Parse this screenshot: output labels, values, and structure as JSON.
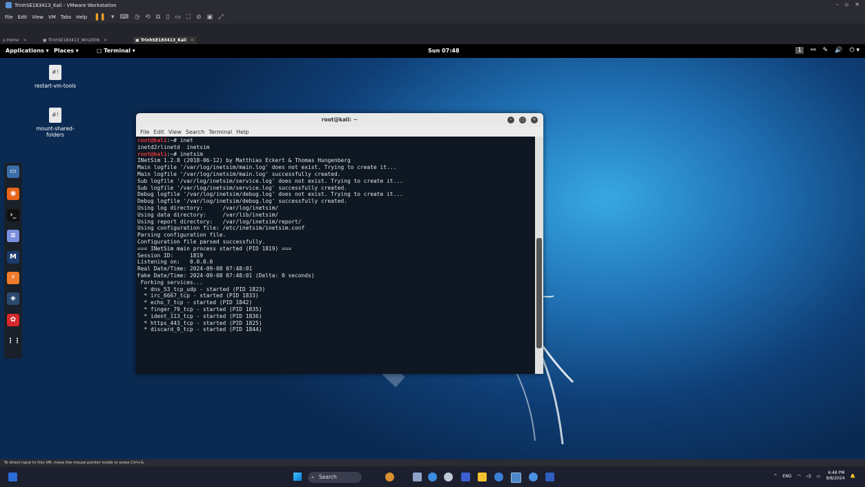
{
  "vm_window": {
    "title": "TrinhSE183413_Kali - VMware Workstation",
    "menu": [
      "File",
      "Edit",
      "View",
      "VM",
      "Tabs",
      "Help"
    ],
    "tabs": [
      {
        "label": "Home"
      },
      {
        "label": "TrinhSE183413_Win2008"
      },
      {
        "label": "TrinhSE183413_Kali"
      }
    ],
    "status_hint": "To direct input to this VM, move the mouse pointer inside or press Ctrl+G."
  },
  "gnome_bar": {
    "applications": "Applications ▾",
    "places": "Places ▾",
    "terminal": "Terminal ▾",
    "clock": "Sun 07:48",
    "workspace": "1"
  },
  "desktop_icons": [
    {
      "label": "restart-vm-tools"
    },
    {
      "label": "mount-shared-folders"
    }
  ],
  "terminal": {
    "title": "root@kali: ~",
    "menu": [
      "File",
      "Edit",
      "View",
      "Search",
      "Terminal",
      "Help"
    ],
    "prompt": "root@kali:~#",
    "lines": [
      {
        "prompt": "root@kali",
        "text": ":~# inet"
      },
      {
        "text": "inetd2rlinetd  inetsim"
      },
      {
        "prompt": "root@kali",
        "text": ":~# inetsim"
      },
      {
        "text": "INetSim 1.2.8 (2018-06-12) by Matthias Eckert & Thomas Hungenberg"
      },
      {
        "text": "Main logfile '/var/log/inetsim/main.log' does not exist. Trying to create it..."
      },
      {
        "text": "Main logfile '/var/log/inetsim/main.log' successfully created."
      },
      {
        "text": "Sub logfile '/var/log/inetsim/service.log' does not exist. Trying to create it..."
      },
      {
        "text": "Sub logfile '/var/log/inetsim/service.log' successfully created."
      },
      {
        "text": "Debug logfile '/var/log/inetsim/debug.log' does not exist. Trying to create it..."
      },
      {
        "text": "Debug logfile '/var/log/inetsim/debug.log' successfully created."
      },
      {
        "text": "Using log directory:      /var/log/inetsim/"
      },
      {
        "text": "Using data directory:     /var/lib/inetsim/"
      },
      {
        "text": "Using report directory:   /var/log/inetsim/report/"
      },
      {
        "text": "Using configuration file: /etc/inetsim/inetsim.conf"
      },
      {
        "text": "Parsing configuration file."
      },
      {
        "text": "Configuration file parsed successfully."
      },
      {
        "text": "=== INetSim main process started (PID 1819) ==="
      },
      {
        "text": "Session ID:     1819"
      },
      {
        "text": "Listening on:   0.0.0.0"
      },
      {
        "text": "Real Date/Time: 2024-09-08 07:48:01"
      },
      {
        "text": "Fake Date/Time: 2024-09-08 07:48:01 (Delta: 0 seconds)"
      },
      {
        "text": " Forking services..."
      },
      {
        "text": "  * dns_53_tcp_udp - started (PID 1823)"
      },
      {
        "text": "  * irc_6667_tcp - started (PID 1833)"
      },
      {
        "text": "  * echo_7_tcp - started (PID 1842)"
      },
      {
        "text": "  * finger_79_tcp - started (PID 1835)"
      },
      {
        "text": "  * ident_113_tcp - started (PID 1836)"
      },
      {
        "text": "  * https_443_tcp - started (PID 1825)"
      },
      {
        "text": "  * discard_9_tcp - started (PID 1844)"
      }
    ]
  },
  "taskbar": {
    "search_placeholder": "Search",
    "lang": "ENG",
    "time": "6:48 PM",
    "date": "9/8/2024"
  }
}
